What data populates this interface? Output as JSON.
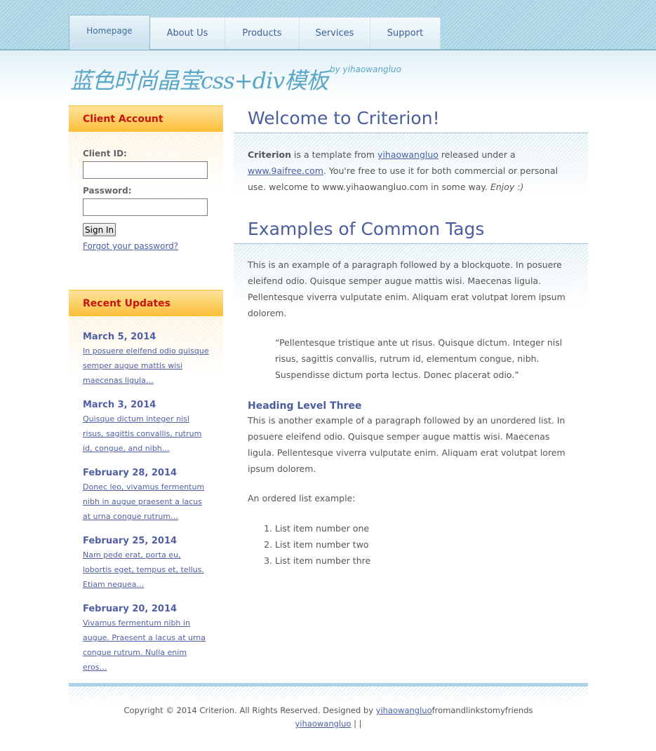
{
  "nav": {
    "tabs": [
      {
        "label": "Homepage"
      },
      {
        "label": "About Us"
      },
      {
        "label": "Products"
      },
      {
        "label": "Services"
      },
      {
        "label": "Support"
      }
    ]
  },
  "header": {
    "title": "蓝色时尚晶莹css+div模板",
    "subtitle": "by yihaowangluo"
  },
  "account": {
    "heading": "Client Account",
    "client_id_label": "Client ID:",
    "client_id_value": "",
    "password_label": "Password:",
    "password_value": "",
    "signin_label": "Sign In",
    "forgot_label": "Forgot your password?"
  },
  "updates": {
    "heading": "Recent Updates",
    "items": [
      {
        "date": "March 5, 2014",
        "text": "In posuere eleifend odio quisque semper augue mattis wisi maecenas ligula…"
      },
      {
        "date": "March 3, 2014",
        "text": "Quisque dictum integer nisl risus, sagittis convallis, rutrum id, congue, and nibh…"
      },
      {
        "date": "February 28, 2014",
        "text": "Donec leo, vivamus fermentum nibh in augue praesent a lacus at urna congue rutrum…"
      },
      {
        "date": "February 25, 2014",
        "text": "Nam pede erat, porta eu, lobortis eget, tempus et, tellus. Etiam nequea…"
      },
      {
        "date": "February 20, 2014",
        "text": "Vivamus fermentum nibh in augue. Praesent a lacus at urna congue rutrum. Nulla enim eros…"
      }
    ]
  },
  "welcome": {
    "title": "Welcome to Criterion!",
    "strong": "Criterion",
    "text1": " is a template from ",
    "link1": "yihaowangluo",
    "text2": " released under a ",
    "link2": "www.9aifree.com",
    "text3": ". You're free to use it for both commercial or personal use. welcome to www.yihaowangluo.com in some way. ",
    "em": "Enjoy :)"
  },
  "examples": {
    "title": "Examples of Common Tags",
    "para1": "This is an example of a paragraph followed by a blockquote. In posuere eleifend odio. Quisque semper augue mattis wisi. Maecenas ligula. Pellentesque viverra vulputate enim. Aliquam erat volutpat lorem ipsum dolorem.",
    "quote": "“Pellentesque tristique ante ut risus. Quisque dictum. Integer nisl risus, sagittis convallis, rutrum id, elementum congue, nibh. Suspendisse dictum porta lectus. Donec placerat odio.”",
    "h3": "Heading Level Three",
    "para2": "This is another example of a paragraph followed by an unordered list. In posuere eleifend odio. Quisque semper augue mattis wisi. Maecenas ligula. Pellentesque viverra vulputate enim. Aliquam erat volutpat lorem ipsum dolorem.",
    "ol_intro": "An ordered list example:",
    "list": [
      "List item number one",
      "List item number two",
      "List item number thre"
    ]
  },
  "footer": {
    "text1": "Copyright © 2014 Criterion. All Rights Reserved. Designed by ",
    "link1": "yihaowangluo",
    "text2": "fromandlinkstomyfriends",
    "link2": "yihaowangluo",
    "sep": " | |"
  },
  "colors": {
    "accent_blue": "#4a5d9f",
    "link_blue": "#4a5fa5",
    "sidebar_heading_red": "#c8140f",
    "sidebar_heading_bg": "#fbbf38",
    "nav_band": "#a9d4e4",
    "title_cyan": "#5aa6c7"
  }
}
